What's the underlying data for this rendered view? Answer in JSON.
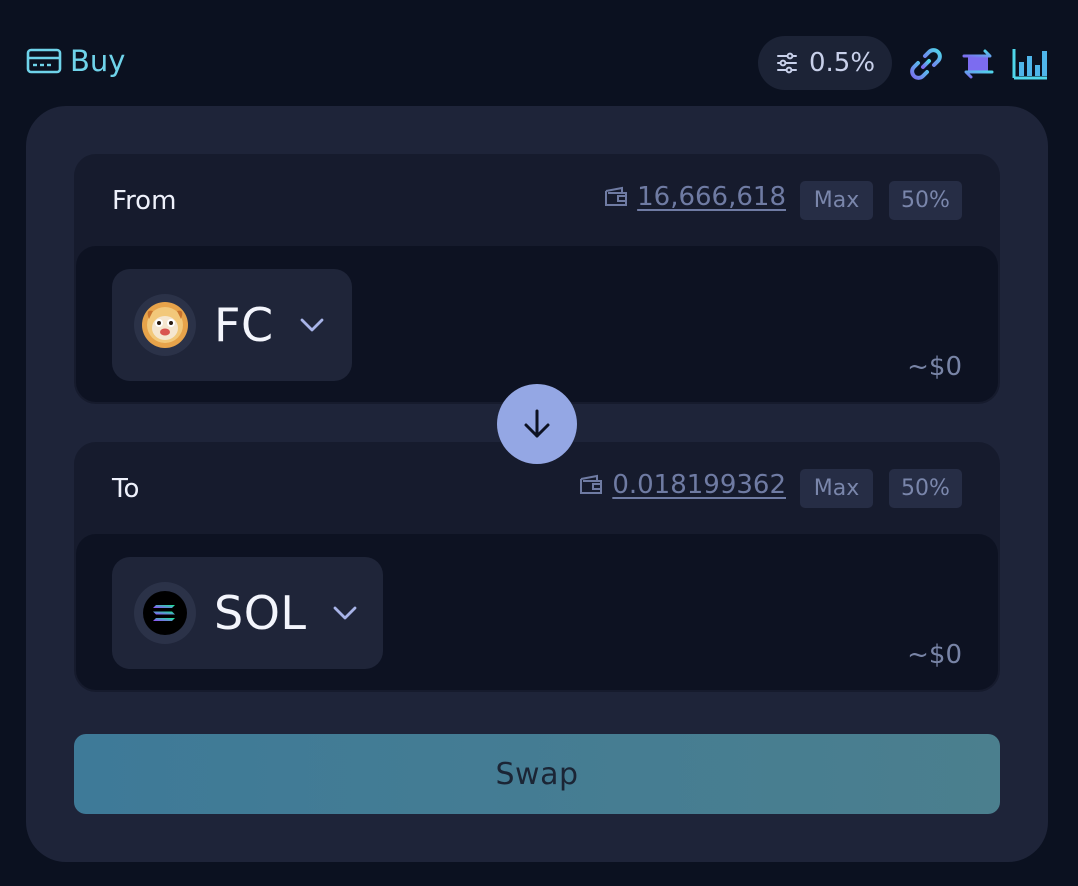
{
  "header": {
    "buy_label": "Buy",
    "slippage": "0.5%",
    "icons": [
      "card-icon",
      "settings-sliders-icon",
      "link-icon",
      "swap-arrows-icon",
      "chart-bar-icon"
    ]
  },
  "from": {
    "label": "From",
    "balance": "16,666,618",
    "max_label": "Max",
    "half_label": "50%",
    "token": "FC",
    "usd": "~$0"
  },
  "to": {
    "label": "To",
    "balance": "0.018199362",
    "max_label": "Max",
    "half_label": "50%",
    "token": "SOL",
    "usd": "~$0"
  },
  "swap_label": "Swap",
  "colors": {
    "background": "#0b1120",
    "card": "#1e2439",
    "accent_cyan": "#6fd3ea",
    "accent_purple": "#7c6cf0",
    "swap_button": "#437c94",
    "direction_button": "#94a7e4"
  }
}
